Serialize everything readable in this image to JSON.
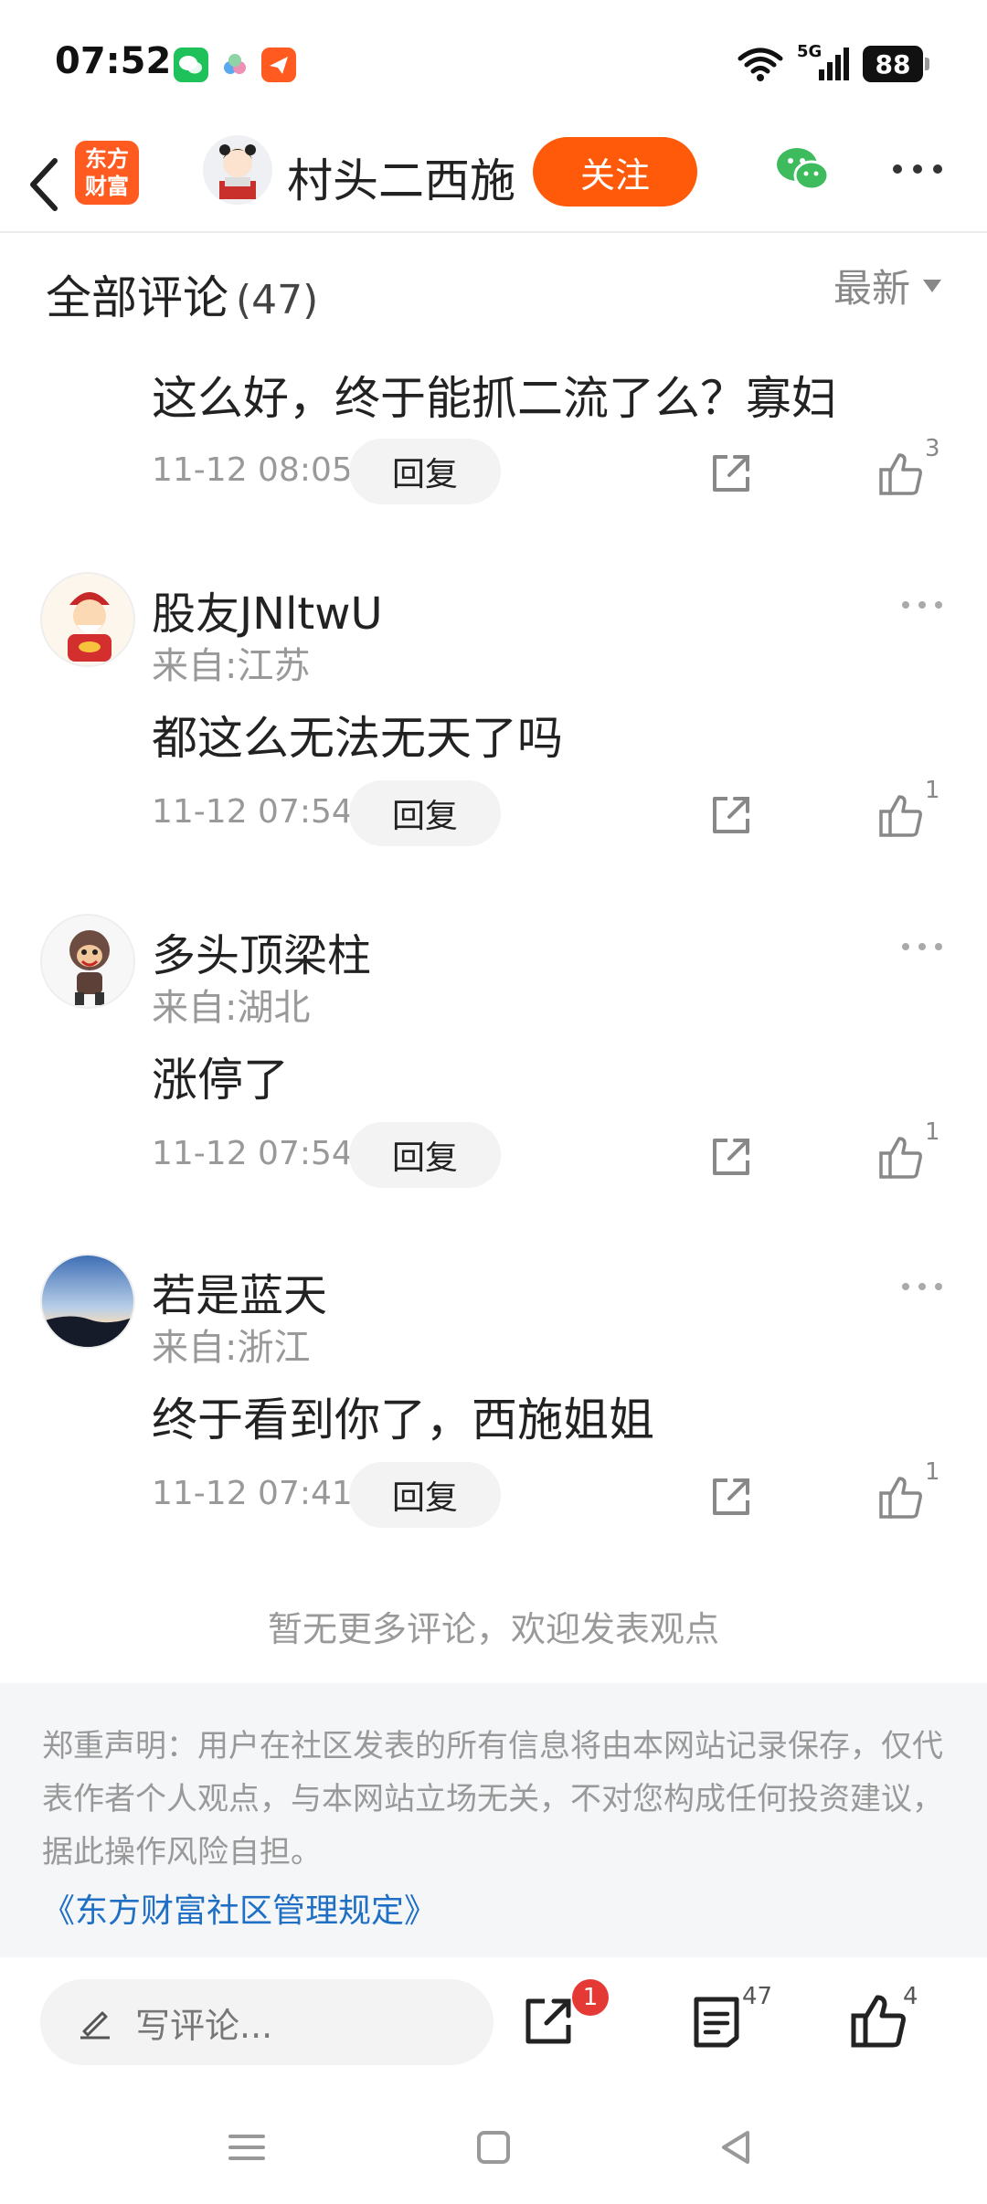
{
  "status_bar": {
    "time": "07:52",
    "network": "5G",
    "battery": "88",
    "app_icons": [
      "wechat-icon",
      "cloud-icon",
      "send-icon"
    ]
  },
  "header": {
    "brand_logo_text_line1": "东方",
    "brand_logo_text_line2": "财富",
    "author_name": "村头二西施",
    "follow_label": "关注"
  },
  "comments_header": {
    "title": "全部评论",
    "count": "(47)",
    "sort_label": "最新"
  },
  "comments": [
    {
      "text": "这么好，终于能抓二流了么？寡妇",
      "time": "11-12 08:05",
      "reply_label": "回复",
      "likes": "3"
    },
    {
      "user": "股友JNltwU",
      "location": "来自:江苏",
      "text": "都这么无法无天了吗",
      "time": "11-12 07:54",
      "reply_label": "回复",
      "likes": "1"
    },
    {
      "user": "多头顶梁柱",
      "location": "来自:湖北",
      "text": "涨停了",
      "time": "11-12 07:54",
      "reply_label": "回复",
      "likes": "1"
    },
    {
      "user": "若是蓝天",
      "location": "来自:浙江",
      "text": "终于看到你了，西施姐姐",
      "time": "11-12 07:41",
      "reply_label": "回复",
      "likes": "1"
    }
  ],
  "no_more_text": "暂无更多评论，欢迎发表观点",
  "disclaimer": {
    "text": "郑重声明：用户在社区发表的所有信息将由本网站记录保存，仅代表作者个人观点，与本网站立场无关，不对您构成任何投资建议，据此操作风险自担。",
    "link": "《东方财富社区管理规定》"
  },
  "bottom_bar": {
    "write_placeholder": "写评论...",
    "share_badge": "1",
    "comment_count": "47",
    "like_count": "4"
  },
  "colors": {
    "accent": "#ff5a0a",
    "link": "#1f6fc5",
    "badge": "#e53935"
  }
}
